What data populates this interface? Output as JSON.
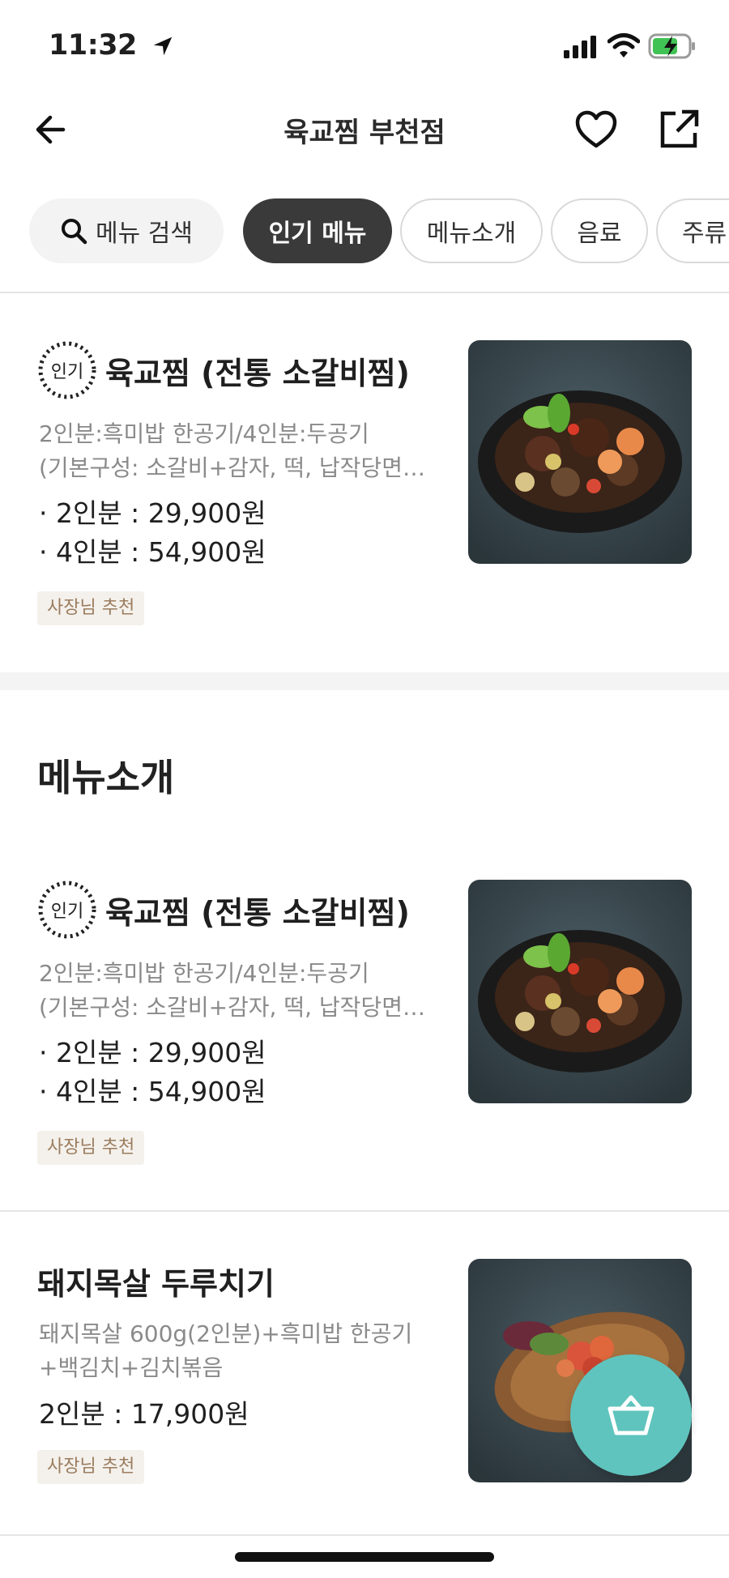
{
  "status_bar": {
    "time": "11:32"
  },
  "header": {
    "title": "육교찜 부천점"
  },
  "tabs": {
    "search_label": "메뉴 검색",
    "items": [
      "인기 메뉴",
      "메뉴소개",
      "음료",
      "주류"
    ]
  },
  "popular_badge": "인기",
  "popular": {
    "name": "육교찜 (전통 소갈비찜)",
    "desc_line1": "2인분:흑미밥 한공기/4인분:두공기",
    "desc_line2": "(기본구성: 소갈비+감자, 떡, 납작당면…",
    "price_line1": "· 2인분 : 29,900원",
    "price_line2": "· 4인분 : 54,900원",
    "tag": "사장님 추천"
  },
  "section": {
    "title": "메뉴소개"
  },
  "menu_items": [
    {
      "name": "육교찜 (전통 소갈비찜)",
      "desc_line1": "2인분:흑미밥 한공기/4인분:두공기",
      "desc_line2": "(기본구성: 소갈비+감자, 떡, 납작당면…",
      "price_line1": "· 2인분 : 29,900원",
      "price_line2": "· 4인분 : 54,900원",
      "tag": "사장님 추천"
    },
    {
      "name": "돼지목살 두루치기",
      "desc_line1": "돼지목살 600g(2인분)+흑미밥 한공기",
      "desc_line2": "+백김치+김치볶음",
      "price_line1": "2인분 : 17,900원",
      "tag": "사장님 추천"
    }
  ],
  "colors": {
    "accent_fab": "#5fc4bd",
    "active_chip": "#3a3a3a",
    "tag_text": "#9b7c5e"
  },
  "icons": [
    "location-arrow-icon",
    "signal-icon",
    "wifi-icon",
    "battery-icon",
    "back-arrow-icon",
    "heart-icon",
    "share-icon",
    "search-icon",
    "cart-basket-icon"
  ]
}
